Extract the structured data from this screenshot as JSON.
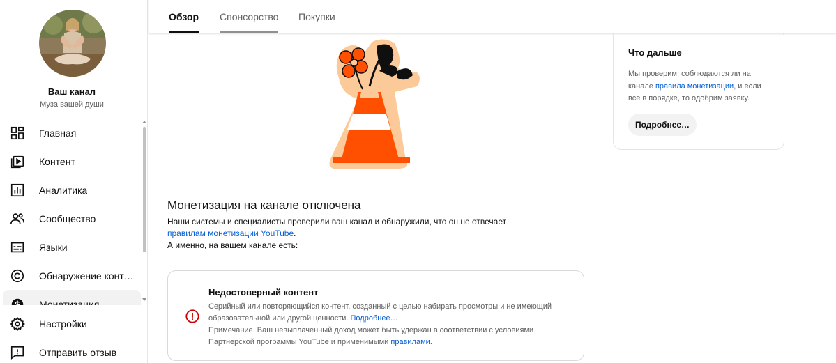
{
  "channel": {
    "title": "Ваш канал",
    "subtitle": "Муза вашей души"
  },
  "sidebar": {
    "items": [
      {
        "label": "Главная",
        "icon": "dashboard-icon"
      },
      {
        "label": "Контент",
        "icon": "content-icon"
      },
      {
        "label": "Аналитика",
        "icon": "analytics-icon"
      },
      {
        "label": "Сообщество",
        "icon": "community-icon"
      },
      {
        "label": "Языки",
        "icon": "subtitles-icon"
      },
      {
        "label": "Обнаружение контента",
        "icon": "copyright-icon"
      },
      {
        "label": "Монетизация",
        "icon": "monetization-icon"
      }
    ],
    "bottom": [
      {
        "label": "Настройки",
        "icon": "gear-icon"
      },
      {
        "label": "Отправить отзыв",
        "icon": "feedback-icon"
      }
    ]
  },
  "tabs": [
    {
      "label": "Обзор"
    },
    {
      "label": "Спонсорство"
    },
    {
      "label": "Покупки"
    }
  ],
  "main": {
    "title": "Монетизация на канале отключена",
    "desc_before": "Наши системы и специалисты проверили ваш канал и обнаружили, что он не отвечает",
    "desc_link": "правилам монетизации YouTube",
    "desc_after": ".",
    "desc_line2": "А именно, на вашем канале есть:"
  },
  "issue": {
    "title": "Недостоверный контент",
    "text1": "Серийный или повторяющийся контент, созданный с целью набирать просмотры и не имеющий образовательной или другой ценности.",
    "link1": "Подробнее…",
    "text2": "Примечание. Ваш невыплаченный доход может быть удержан в соответствии с условиями Партнерской программы YouTube и применимыми",
    "link2": "правилами",
    "text2_end": "."
  },
  "next": {
    "title": "Что дальше",
    "text_before": "Мы проверим, соблюдаются ли на канале",
    "link": "правила монетизации",
    "text_after": ", и если все в порядке, то одобрим заявку.",
    "button": "Подробнее…"
  },
  "colors": {
    "link": "#065fd4",
    "accent_orange": "#fe5000",
    "error_red": "#cc0000"
  }
}
